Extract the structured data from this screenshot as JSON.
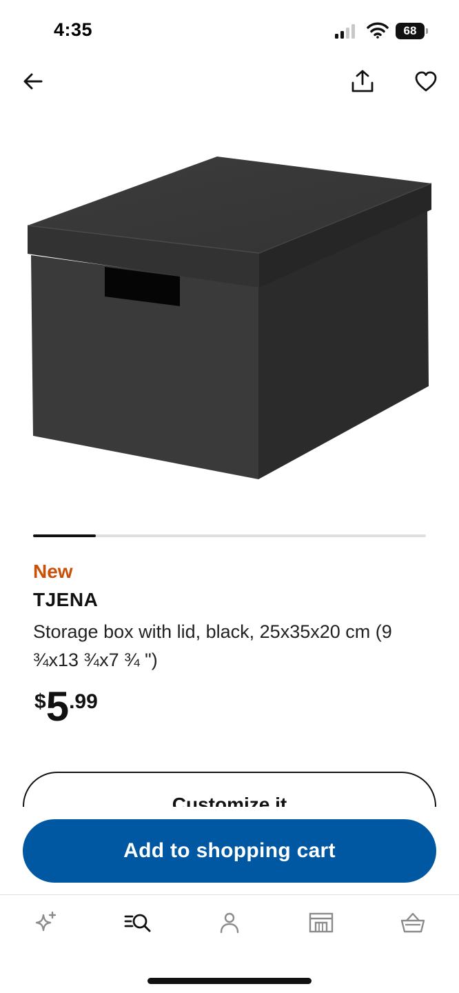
{
  "status_bar": {
    "time": "4:35",
    "battery": "68",
    "icons": [
      "signal-icon",
      "wifi-icon",
      "battery-icon"
    ]
  },
  "top_nav": {
    "icons": [
      "back-arrow-icon",
      "share-icon",
      "heart-icon"
    ]
  },
  "carousel": {
    "current_fraction": 0.16
  },
  "product": {
    "badge": "New",
    "name": "TJENA",
    "description": "Storage box with lid, black, 25x35x20 cm (9 ¾x13 ¾x7 ¾ \")",
    "price": {
      "currency": "$",
      "integer": "5",
      "decimal": ".99"
    }
  },
  "actions": {
    "customize_label": "Customize it",
    "add_to_cart_label": "Add to shopping cart"
  },
  "tab_bar": {
    "tabs": [
      {
        "icon": "sparkle-icon",
        "active": false
      },
      {
        "icon": "search-list-icon",
        "active": true
      },
      {
        "icon": "profile-icon",
        "active": false
      },
      {
        "icon": "store-icon",
        "active": false
      },
      {
        "icon": "basket-icon",
        "active": false
      }
    ]
  },
  "colors": {
    "brand_blue": "#0058a3",
    "new_badge": "#ca5008",
    "text_dark": "#111111",
    "tab_inactive": "#8a8a8a"
  }
}
